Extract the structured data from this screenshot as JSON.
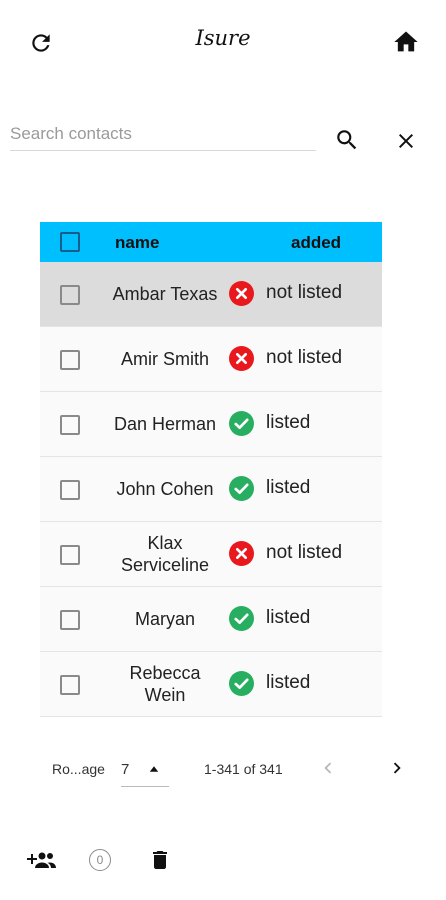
{
  "header": {
    "title": "Isure",
    "refresh_icon": "refresh-icon",
    "home_icon": "home-icon"
  },
  "search": {
    "placeholder": "Search contacts",
    "value": ""
  },
  "table": {
    "header_color": "#00bfff",
    "columns": [
      "name",
      "added"
    ],
    "rows": [
      {
        "name": "Ambar Texas",
        "added": "not listed",
        "status": "error",
        "selected": true
      },
      {
        "name": "Amir Smith",
        "added": "not listed",
        "status": "error",
        "selected": false
      },
      {
        "name": "Dan Herman",
        "added": "listed",
        "status": "ok",
        "selected": false
      },
      {
        "name": "John Cohen",
        "added": "listed",
        "status": "ok",
        "selected": false
      },
      {
        "name": "Klax Serviceline",
        "added": "not listed",
        "status": "error",
        "selected": false
      },
      {
        "name": "Maryan",
        "added": "listed",
        "status": "ok",
        "selected": false
      },
      {
        "name": "Rebecca Wein",
        "added": "listed",
        "status": "ok",
        "selected": false
      }
    ],
    "status_colors": {
      "ok": "#27ae60",
      "error": "#e8181c"
    }
  },
  "pagination": {
    "rows_per_page_label": "Ro...age",
    "rows_per_page_value": "7",
    "range_label": "1-341 of 341"
  },
  "footer": {
    "count_badge": "0"
  }
}
